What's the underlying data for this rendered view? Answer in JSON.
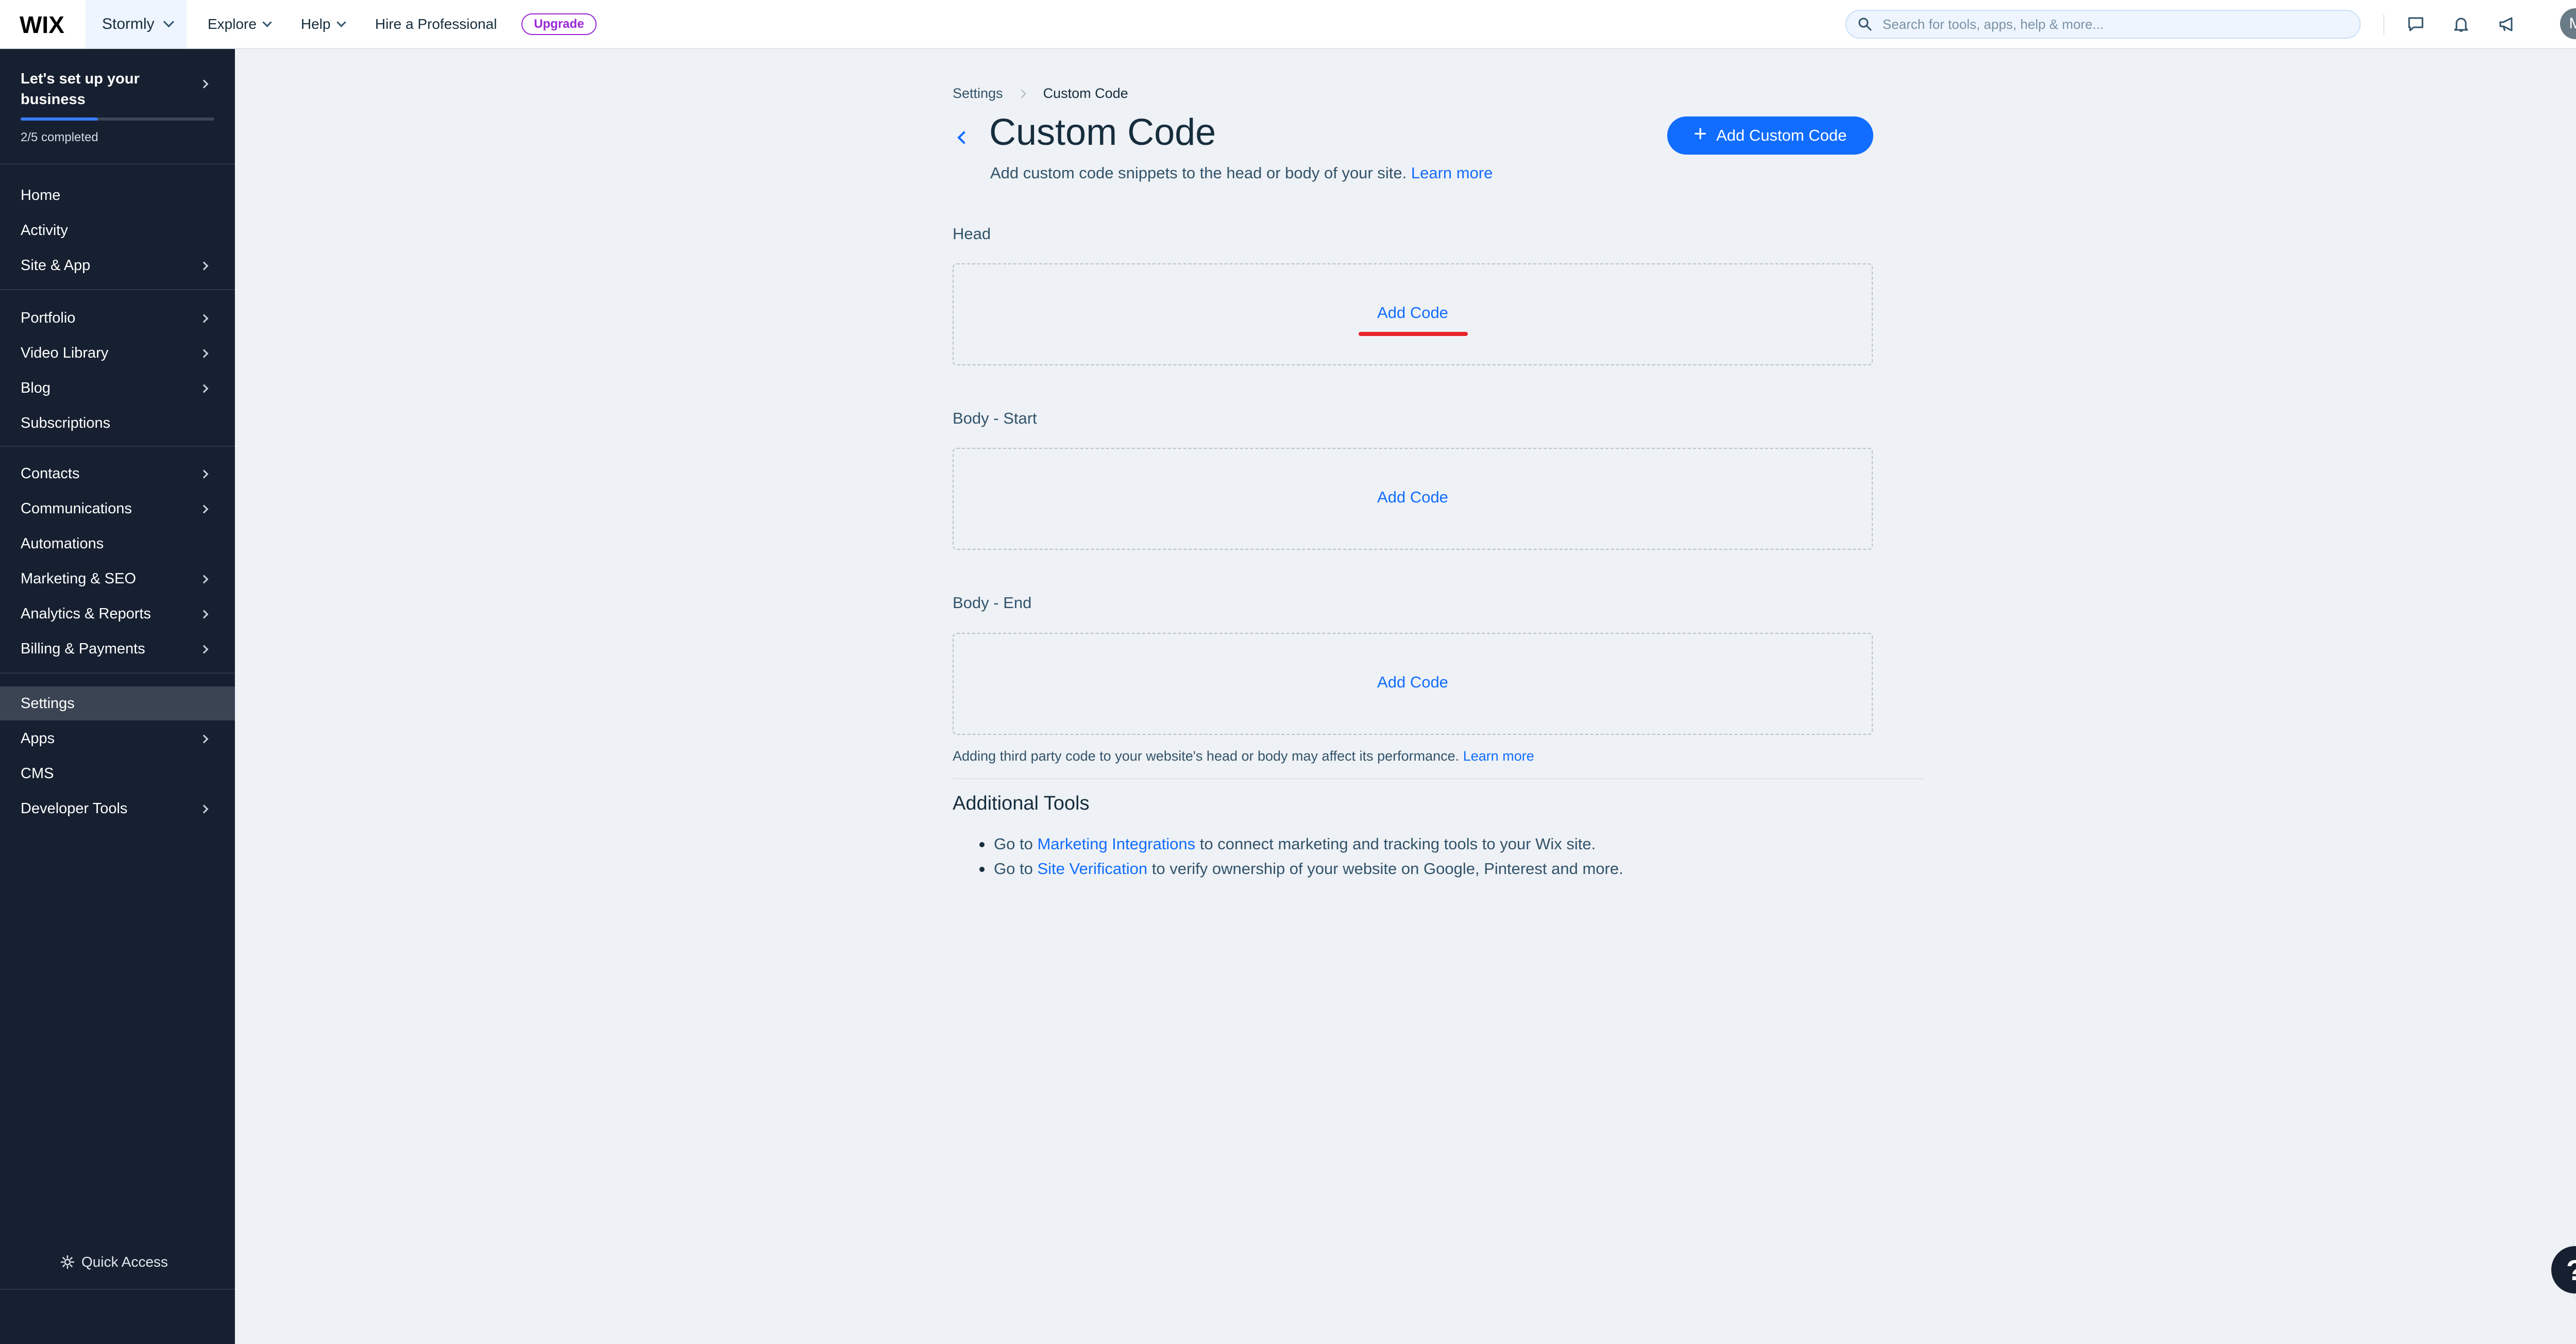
{
  "topbar": {
    "logo_text": "WIX",
    "site_name": "Stormly",
    "nav": [
      {
        "label": "Explore"
      },
      {
        "label": "Help"
      },
      {
        "label": "Hire a Professional"
      }
    ],
    "upgrade_label": "Upgrade",
    "search_placeholder": "Search for tools, apps, help & more...",
    "icons": [
      "chat-icon",
      "bell-icon",
      "megaphone-icon"
    ],
    "avatar_initial": "M"
  },
  "sidebar": {
    "setup_title": "Let's set up your business",
    "setup_progress": "2/5 completed",
    "setup_progress_fraction": 0.4,
    "items": [
      {
        "label": "Home"
      },
      {
        "label": "Activity"
      },
      {
        "label": "Site & App"
      },
      {
        "label": "Portfolio"
      },
      {
        "label": "Video Library"
      },
      {
        "label": "Blog"
      },
      {
        "label": "Subscriptions"
      },
      {
        "label": "Contacts"
      },
      {
        "label": "Communications"
      },
      {
        "label": "Automations"
      },
      {
        "label": "Marketing & SEO"
      },
      {
        "label": "Analytics & Reports"
      },
      {
        "label": "Billing & Payments"
      },
      {
        "label": "Settings"
      },
      {
        "label": "Apps"
      },
      {
        "label": "CMS"
      },
      {
        "label": "Developer Tools"
      }
    ],
    "quick_access": "Quick Access"
  },
  "main": {
    "breadcrumb": [
      "Settings",
      "Custom Code"
    ],
    "title": "Custom Code",
    "subtitle": "Add custom code snippets to the head or body of your site.",
    "learn_more": "Learn more",
    "add_button": "Add Custom Code",
    "sections": [
      {
        "label": "Head",
        "action": "Add Code"
      },
      {
        "label": "Body - Start",
        "action": "Add Code"
      },
      {
        "label": "Body - End",
        "action": "Add Code"
      }
    ],
    "note": "Adding third party code to your website's head or body may affect its performance.",
    "note_link": "Learn more",
    "tools_title": "Additional Tools",
    "tools": [
      {
        "prefix": "Go to",
        "link": "Marketing Integrations",
        "suffix": "to connect marketing and tracking tools to your Wix site."
      },
      {
        "prefix": "Go to",
        "link": "Site Verification",
        "suffix": "to verify ownership of your website on Google, Pinterest and more."
      }
    ]
  },
  "help_label": "?",
  "colors": {
    "accent": "#116dff",
    "sidebar_bg": "#162030",
    "upgrade": "#9a27d5",
    "highlight": "#e8232b"
  }
}
